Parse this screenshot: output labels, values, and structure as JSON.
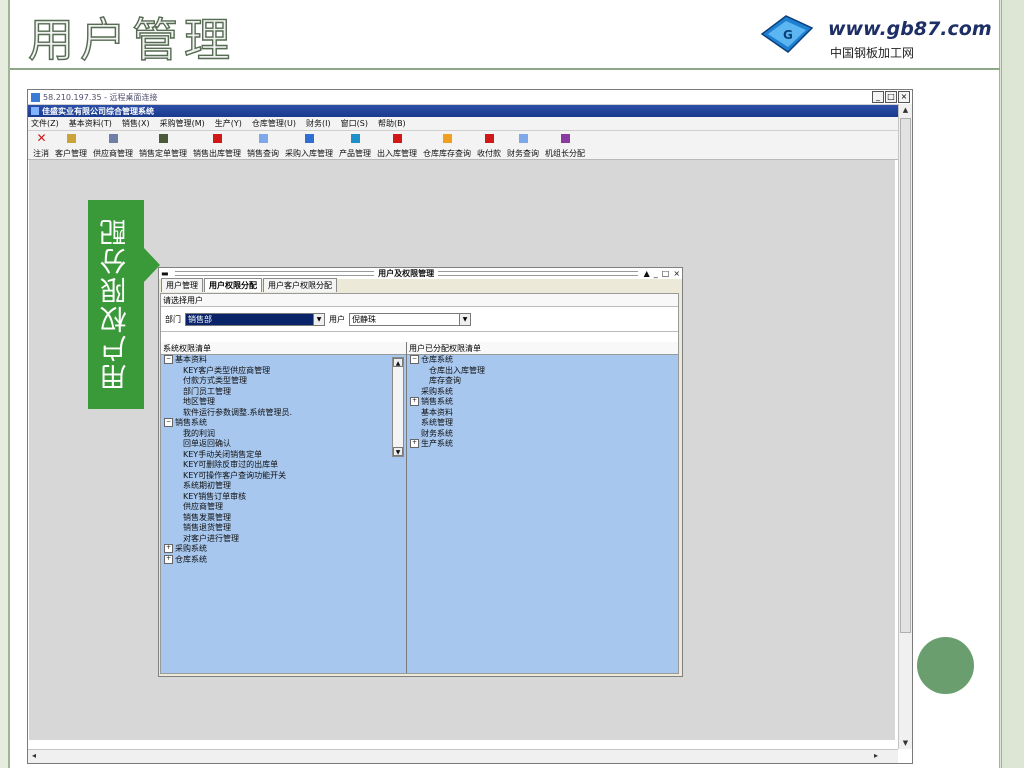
{
  "slide": {
    "title": "用户管理",
    "callout_text": "用户权限分配",
    "logo_url": "www.gb87.com",
    "logo_sub": "中国钢板加工网"
  },
  "remote_window": {
    "title": "58.210.197.35 - 远程桌面连接",
    "controls": [
      "_",
      "□",
      "×"
    ]
  },
  "app": {
    "title": "佳盛实业有限公司综合管理系统",
    "menu": [
      "文件(Z)",
      "基本资料(T)",
      "销售(X)",
      "采购管理(M)",
      "生产(Y)",
      "仓库管理(U)",
      "财务(I)",
      "窗口(S)",
      "帮助(B)"
    ],
    "toolbar": [
      {
        "label": "注消",
        "icon": "exit-icon",
        "color": "#d01818"
      },
      {
        "label": "客户管理",
        "icon": "customer-icon",
        "color": "#c9a43a"
      },
      {
        "label": "供应商管理",
        "icon": "supplier-icon",
        "color": "#6f7fa5"
      },
      {
        "label": "销售定单管理",
        "icon": "sales-order-icon",
        "color": "#4a5a3a"
      },
      {
        "label": "销售出库管理",
        "icon": "sales-outbound-icon",
        "color": "#d01818"
      },
      {
        "label": "销售查询",
        "icon": "sales-query-icon",
        "color": "#7fa8e8"
      },
      {
        "label": "采购入库管理",
        "icon": "purchase-inbound-icon",
        "color": "#2f6fd2"
      },
      {
        "label": "产品管理",
        "icon": "product-icon",
        "color": "#1e8fc9"
      },
      {
        "label": "出入库管理",
        "icon": "stock-io-icon",
        "color": "#d01818"
      },
      {
        "label": "仓库库存查询",
        "icon": "inventory-query-icon",
        "color": "#f0a020"
      },
      {
        "label": "收付款",
        "icon": "payment-icon",
        "color": "#d01818"
      },
      {
        "label": "财务查询",
        "icon": "finance-query-icon",
        "color": "#7fa8e8"
      },
      {
        "label": "机组长分配",
        "icon": "crew-assign-icon",
        "color": "#8a3aa0"
      }
    ]
  },
  "dialog": {
    "title": "用户及权限管理",
    "controls": [
      "▲",
      "_",
      "□",
      "×"
    ],
    "tabs": [
      "用户管理",
      "用户权限分配",
      "用户客户权限分配"
    ],
    "select_header": "请选择用户",
    "dept_label": "部门",
    "dept_value": "销售部",
    "user_label": "用户",
    "user_value": "倪静珠",
    "left_pane_title": "系统权限清单",
    "right_pane_title": "用户已分配权限清单",
    "left_tree": [
      {
        "label": "基本资料",
        "level": 0,
        "exp": "⊟"
      },
      {
        "label": "KEY客户类型供应商管理",
        "level": 1
      },
      {
        "label": "付款方式类型管理",
        "level": 1
      },
      {
        "label": "部门员工管理",
        "level": 1
      },
      {
        "label": "地区管理",
        "level": 1
      },
      {
        "label": "软件运行参数调整.系统管理员.",
        "level": 1
      },
      {
        "label": "销售系统",
        "level": 0,
        "exp": "⊟"
      },
      {
        "label": "我的利润",
        "level": 1
      },
      {
        "label": "回单返回确认",
        "level": 1
      },
      {
        "label": "KEY手动关闭销售定单",
        "level": 1
      },
      {
        "label": "KEY可删除反审过的出库单",
        "level": 1
      },
      {
        "label": "KEY可操作客户查询功能开关",
        "level": 1
      },
      {
        "label": "系统期初管理",
        "level": 1
      },
      {
        "label": "KEY销售订单审核",
        "level": 1
      },
      {
        "label": "供应商管理",
        "level": 1
      },
      {
        "label": "销售发票管理",
        "level": 1
      },
      {
        "label": "销售退货管理",
        "level": 1
      },
      {
        "label": "对客户进行管理",
        "level": 1
      },
      {
        "label": "采购系统",
        "level": 0,
        "exp": "⊞"
      },
      {
        "label": "仓库系统",
        "level": 0,
        "exp": "⊞"
      }
    ],
    "right_tree": [
      {
        "label": "仓库系统",
        "level": 0,
        "exp": "⊟"
      },
      {
        "label": "仓库出入库管理",
        "level": 1
      },
      {
        "label": "库存查询",
        "level": 1
      },
      {
        "label": "采购系统",
        "level": 0
      },
      {
        "label": "销售系统",
        "level": 0,
        "exp": "⊞"
      },
      {
        "label": "基本资料",
        "level": 0
      },
      {
        "label": "系统管理",
        "level": 0
      },
      {
        "label": "财务系统",
        "level": 0
      },
      {
        "label": "生产系统",
        "level": 0,
        "exp": "⊞"
      }
    ]
  }
}
